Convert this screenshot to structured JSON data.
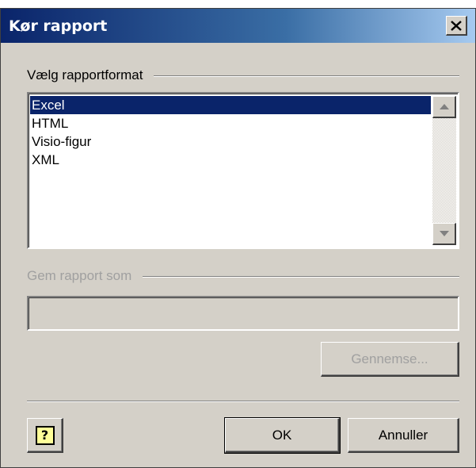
{
  "dialog": {
    "title": "Kør rapport",
    "close_glyph": "✕"
  },
  "format_group": {
    "label": "Vælg rapportformat",
    "items": [
      {
        "label": "Excel",
        "selected": true
      },
      {
        "label": "HTML",
        "selected": false
      },
      {
        "label": "Visio-figur",
        "selected": false
      },
      {
        "label": "XML",
        "selected": false
      }
    ]
  },
  "save_group": {
    "label": "Gem rapport som",
    "value": "",
    "browse_label": "Gennemse..."
  },
  "buttons": {
    "help_glyph": "?",
    "ok_label": "OK",
    "cancel_label": "Annuller"
  },
  "colors": {
    "title_start": "#0a246a",
    "title_end": "#a6caf0",
    "dialog_bg": "#d4d0c8",
    "selection": "#0a246a",
    "disabled_text": "#a0a0a0"
  }
}
